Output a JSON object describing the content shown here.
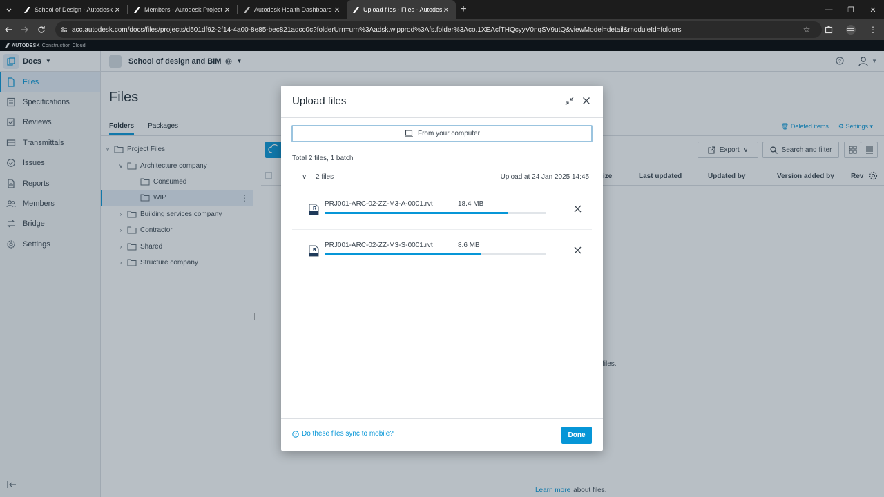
{
  "browser": {
    "tabs": [
      {
        "title": "School of Design - Autodesk D",
        "active": false
      },
      {
        "title": "Members - Autodesk Project A",
        "active": false
      },
      {
        "title": "Autodesk Health Dashboard St",
        "active": false
      },
      {
        "title": "Upload files - Files - Autodesk I",
        "active": true
      }
    ],
    "new_tab_icon": "plus-icon",
    "url": "acc.autodesk.com/docs/files/projects/d501df92-2f14-4a00-8e85-bec821adcc0c?folderUrn=urn%3Aadsk.wipprod%3Afs.folder%3Aco.1XEAcfTHQcyyV0nqSV9utQ&viewModel=detail&moduleId=folders"
  },
  "brandbar": {
    "brand": "AUTODESK",
    "product": "Construction Cloud"
  },
  "topnav": {
    "module": "Docs",
    "project": "School of design and BIM"
  },
  "sidebar": {
    "items": [
      {
        "label": "Files",
        "icon": "file-icon",
        "active": true
      },
      {
        "label": "Specifications",
        "icon": "specifications-icon",
        "active": false
      },
      {
        "label": "Reviews",
        "icon": "reviews-icon",
        "active": false
      },
      {
        "label": "Transmittals",
        "icon": "transmittals-icon",
        "active": false
      },
      {
        "label": "Issues",
        "icon": "issues-icon",
        "active": false
      },
      {
        "label": "Reports",
        "icon": "reports-icon",
        "active": false
      },
      {
        "label": "Members",
        "icon": "members-icon",
        "active": false
      },
      {
        "label": "Bridge",
        "icon": "bridge-icon",
        "active": false
      },
      {
        "label": "Settings",
        "icon": "settings-icon",
        "active": false
      }
    ]
  },
  "main": {
    "title": "Files",
    "tabs": [
      "Folders",
      "Packages"
    ],
    "deleted_items": "Deleted items",
    "settings": "Settings",
    "export": "Export",
    "search_filter": "Search and filter",
    "columns": [
      "ize",
      "Last updated",
      "Updated by",
      "Version added by",
      "Rev"
    ],
    "empty_text_suffix": "files.",
    "learn_more": "Learn more",
    "learn_more_suffix": "about files."
  },
  "tree": [
    {
      "label": "Project Files",
      "depth": 0,
      "expanded": true,
      "selected": false
    },
    {
      "label": "Architecture company",
      "depth": 1,
      "expanded": true,
      "selected": false
    },
    {
      "label": "Consumed",
      "depth": 2,
      "expanded": null,
      "selected": false
    },
    {
      "label": "WIP",
      "depth": 2,
      "expanded": null,
      "selected": true
    },
    {
      "label": "Building services company",
      "depth": 1,
      "expanded": false,
      "selected": false
    },
    {
      "label": "Contractor",
      "depth": 1,
      "expanded": false,
      "selected": false
    },
    {
      "label": "Shared",
      "depth": 1,
      "expanded": false,
      "selected": false
    },
    {
      "label": "Structure company",
      "depth": 1,
      "expanded": false,
      "selected": false
    }
  ],
  "dialog": {
    "title": "Upload files",
    "from_computer": "From your computer",
    "total": "Total 2 files, 1 batch",
    "batch_count": "2 files",
    "batch_date": "Upload at 24 Jan 2025 14:45",
    "files": [
      {
        "name": "PRJ001-ARC-02-ZZ-M3-A-0001.rvt",
        "size": "18.4 MB",
        "progress": 0.83
      },
      {
        "name": "PRJ001-ARC-02-ZZ-M3-S-0001.rvt",
        "size": "8.6 MB",
        "progress": 0.71
      }
    ],
    "sync_link": "Do these files sync to mobile?",
    "done": "Done"
  },
  "colors": {
    "accent": "#0696d7",
    "overlay": "rgba(40,60,80,0.33)"
  }
}
